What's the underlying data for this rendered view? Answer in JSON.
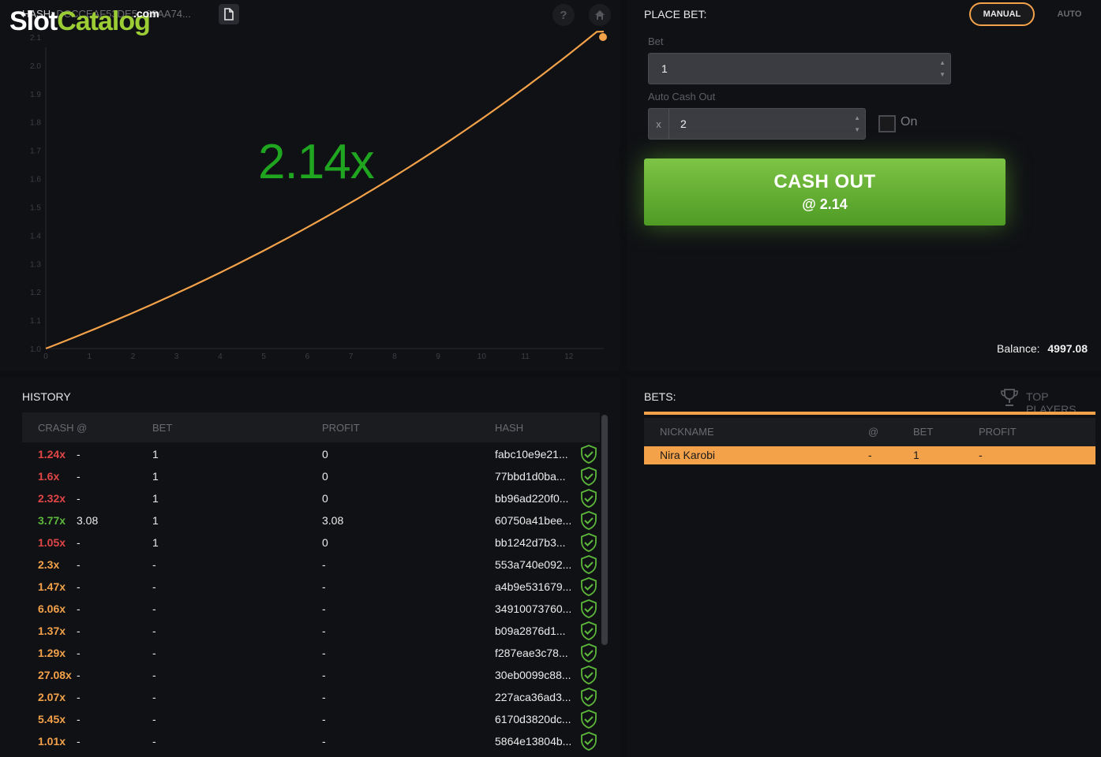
{
  "logo": {
    "slot": "Slot",
    "catalog": "Catalog",
    "dotcom": ".com"
  },
  "hash_label": "HASH:",
  "hash_value": "DCCCEAF53DE5...69AA74...",
  "icons": {
    "document": "document-icon",
    "help": "help-icon",
    "home": "home-icon",
    "trophy": "trophy-icon",
    "verified": "shield-check-icon"
  },
  "help_glyph": "?",
  "multiplier": "2.14x",
  "chart_data": {
    "type": "line",
    "title": "",
    "xlabel": "",
    "ylabel": "",
    "xlim": [
      0,
      12.8
    ],
    "ylim": [
      1.0,
      2.1
    ],
    "xticks": [
      "0",
      "1",
      "2",
      "3",
      "4",
      "5",
      "6",
      "7",
      "8",
      "9",
      "10",
      "11",
      "12"
    ],
    "yticks": [
      "1.0",
      "1.1",
      "1.2",
      "1.3",
      "1.4",
      "1.5",
      "1.6",
      "1.7",
      "1.8",
      "1.9",
      "2.0",
      "2.1"
    ],
    "growth_rate": 0.0594,
    "x_end": 12.8,
    "end_value": 2.14,
    "line_color": "#f4a24a",
    "grid": false
  },
  "place_bet": {
    "title": "PLACE BET:",
    "manual": "MANUAL",
    "auto": "AUTO",
    "bet_label": "Bet",
    "bet_value": "1",
    "auto_cashout_label": "Auto Cash Out",
    "x_prefix": "x",
    "auto_cashout_value": "2",
    "on_label": "On",
    "cashout_line1": "CASH OUT",
    "cashout_line2": "@ 2.14",
    "balance_label": "Balance:",
    "balance_value": "4997.08"
  },
  "history": {
    "title": "HISTORY",
    "columns": {
      "crash": "CRASH @",
      "bet": "BET",
      "profit": "PROFIT",
      "hash": "HASH"
    },
    "rows": [
      {
        "crash": "1.24x",
        "cashed": "-",
        "bet": "1",
        "profit": "0",
        "hash": "fabc10e9e21...",
        "color": "#e14646"
      },
      {
        "crash": "1.6x",
        "cashed": "-",
        "bet": "1",
        "profit": "0",
        "hash": "77bbd1d0ba...",
        "color": "#e14646"
      },
      {
        "crash": "2.32x",
        "cashed": "-",
        "bet": "1",
        "profit": "0",
        "hash": "bb96ad220f0...",
        "color": "#e14646"
      },
      {
        "crash": "3.77x",
        "cashed": "3.08",
        "bet": "1",
        "profit": "3.08",
        "hash": "60750a41bee...",
        "color": "#5cb83a"
      },
      {
        "crash": "1.05x",
        "cashed": "-",
        "bet": "1",
        "profit": "0",
        "hash": "bb1242d7b3...",
        "color": "#e14646"
      },
      {
        "crash": "2.3x",
        "cashed": "-",
        "bet": "-",
        "profit": "-",
        "hash": "553a740e092...",
        "color": "#f4a24a"
      },
      {
        "crash": "1.47x",
        "cashed": "-",
        "bet": "-",
        "profit": "-",
        "hash": "a4b9e531679...",
        "color": "#f4a24a"
      },
      {
        "crash": "6.06x",
        "cashed": "-",
        "bet": "-",
        "profit": "-",
        "hash": "34910073760...",
        "color": "#f4a24a"
      },
      {
        "crash": "1.37x",
        "cashed": "-",
        "bet": "-",
        "profit": "-",
        "hash": "b09a2876d1...",
        "color": "#f4a24a"
      },
      {
        "crash": "1.29x",
        "cashed": "-",
        "bet": "-",
        "profit": "-",
        "hash": "f287eae3c78...",
        "color": "#f4a24a"
      },
      {
        "crash": "27.08x",
        "cashed": "-",
        "bet": "-",
        "profit": "-",
        "hash": "30eb0099c88...",
        "color": "#f4a24a"
      },
      {
        "crash": "2.07x",
        "cashed": "-",
        "bet": "-",
        "profit": "-",
        "hash": "227aca36ad3...",
        "color": "#f4a24a"
      },
      {
        "crash": "5.45x",
        "cashed": "-",
        "bet": "-",
        "profit": "-",
        "hash": "6170d3820dc...",
        "color": "#f4a24a"
      },
      {
        "crash": "1.01x",
        "cashed": "-",
        "bet": "-",
        "profit": "-",
        "hash": "5864e13804b...",
        "color": "#f4a24a"
      }
    ]
  },
  "bets": {
    "title": "BETS:",
    "top_players": "TOP PLAYERS",
    "columns": {
      "nickname": "NICKNAME",
      "at": "@",
      "bet": "BET",
      "profit": "PROFIT"
    },
    "rows": [
      {
        "nickname": "Nira Karobi",
        "at": "-",
        "bet": "1",
        "profit": "-"
      }
    ]
  },
  "colors": {
    "accent": "#f4a24a",
    "green": "#5cb83a",
    "red": "#e14646",
    "multiplier": "#1fa51f"
  }
}
